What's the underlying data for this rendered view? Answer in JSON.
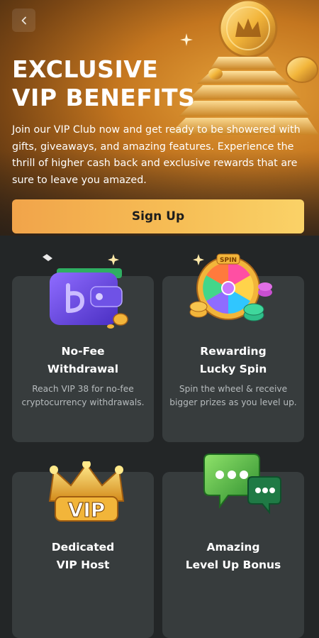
{
  "hero": {
    "back_icon": "chevron-left-icon",
    "title_line1": "EXCLUSIVE",
    "title_line2": "VIP BENEFITS",
    "description": "Join our VIP Club now and get ready to be showered with gifts, giveaways, and amazing features. Experience the thrill of higher cash back and exclusive rewards that are sure to leave you amazed.",
    "signup_label": "Sign Up"
  },
  "benefits": [
    {
      "icon": "wallet-icon",
      "title_line1": "No-Fee",
      "title_line2": "Withdrawal",
      "description": "Reach VIP 38 for no-fee cryptocurrency withdrawals."
    },
    {
      "icon": "lucky-wheel-icon",
      "wheel_label": "SPIN",
      "title_line1": "Rewarding",
      "title_line2": "Lucky Spin",
      "description": "Spin the wheel & receive bigger prizes as you level up."
    },
    {
      "icon": "crown-icon",
      "badge_label": "VIP",
      "title_line1": "Dedicated",
      "title_line2": "VIP Host",
      "description": ""
    },
    {
      "icon": "chat-bubbles-icon",
      "title_line1": "Amazing",
      "title_line2": "Level Up Bonus",
      "description": ""
    }
  ],
  "colors": {
    "page_bg": "#232627",
    "card_bg": "#373c3d",
    "accent_start": "#f1a44a",
    "accent_end": "#fad267",
    "muted_text": "#b7bcbe"
  }
}
